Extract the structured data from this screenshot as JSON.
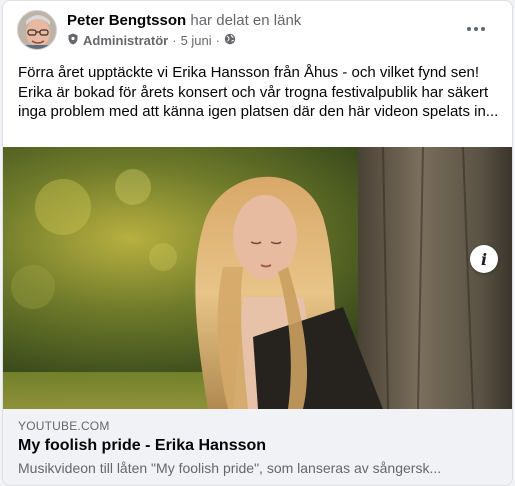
{
  "post": {
    "author_name": "Peter Bengtsson",
    "author_action": "har delat en länk",
    "role": "Administratör",
    "separator": "·",
    "date": "5 juni",
    "privacy_icon": "globe-icon",
    "text": "Förra året upptäckte vi Erika Hansson från Åhus - och vilket fynd sen! Erika är bokad för årets konsert och vår trogna festivalpublik har säkert inga problem med att känna igen platsen där den här videon spelats in..."
  },
  "link_preview": {
    "domain": "YOUTUBE.COM",
    "title": "My foolish pride - Erika Hansson",
    "description": "Musikvideon till låten \"My foolish pride\", som lanseras av sångersk...",
    "info_label": "i"
  },
  "colors": {
    "text_primary": "#050505",
    "text_secondary": "#65676b",
    "footer_bg": "#f0f2f5",
    "card_bg": "#ffffff"
  }
}
